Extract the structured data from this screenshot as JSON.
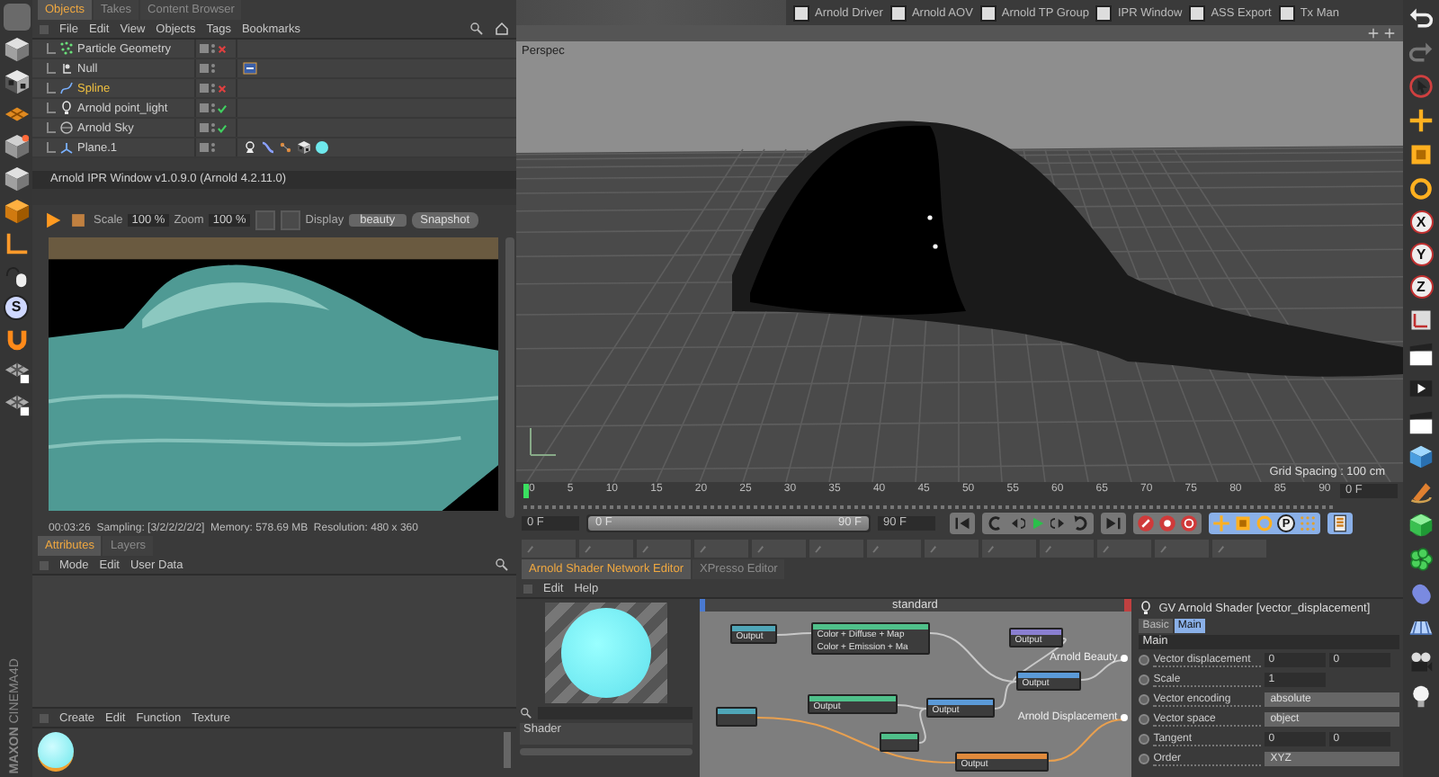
{
  "plugin_toolbar": {
    "items": [
      "Arnold Driver",
      "Arnold AOV",
      "Arnold TP Group",
      "IPR Window",
      "ASS Export",
      "Tx Man"
    ]
  },
  "left_toolbar": {
    "snap_label": "S"
  },
  "logo": {
    "brand": "MAXON",
    "product": "CINEMA4D"
  },
  "object_manager": {
    "tabs": [
      {
        "label": "Objects",
        "selected": true
      },
      {
        "label": "Takes",
        "selected": false
      },
      {
        "label": "Content Browser",
        "selected": false
      }
    ],
    "menu": [
      "File",
      "Edit",
      "View",
      "Objects",
      "Tags",
      "Bookmarks"
    ],
    "objects": [
      {
        "name": "Particle Geometry",
        "kind": "particles",
        "enabled": false,
        "selected": false
      },
      {
        "name": "Null",
        "kind": "null",
        "selected": false,
        "tags": [
          {
            "kind": "node"
          }
        ]
      },
      {
        "name": "Spline",
        "kind": "spline",
        "enabled": false,
        "selected": true
      },
      {
        "name": "Arnold point_light",
        "kind": "light",
        "enabled": true,
        "selected": false
      },
      {
        "name": "Arnold Sky",
        "kind": "sky",
        "enabled": true,
        "selected": false
      },
      {
        "name": "Plane.1",
        "kind": "plane",
        "selected": false,
        "tags": [
          {
            "kind": "lamp"
          },
          {
            "kind": "curve"
          },
          {
            "kind": "dots"
          },
          {
            "kind": "checker"
          },
          {
            "kind": "sphere"
          }
        ]
      }
    ]
  },
  "ipr_window": {
    "title": "Arnold IPR Window v1.0.9.0 (Arnold 4.2.11.0)",
    "scale_label": "Scale",
    "scale": "100 %",
    "zoom_label": "Zoom",
    "zoom": "100 %",
    "display_label": "Display",
    "display": "beauty",
    "snapshot": "Snapshot",
    "status": "00:03:26  Sampling: [3/2/2/2/2/2]  Memory: 578.69 MB  Resolution: 480 x 360"
  },
  "attribute_manager": {
    "tabs": [
      {
        "label": "Attributes",
        "selected": true
      },
      {
        "label": "Layers",
        "selected": false
      }
    ],
    "menu": [
      "Mode",
      "Edit",
      "User Data"
    ]
  },
  "material_manager": {
    "menu": [
      "Create",
      "Edit",
      "Function",
      "Texture"
    ]
  },
  "viewport": {
    "camera": "Perspec",
    "grid_spacing": "Grid Spacing : 100 cm"
  },
  "timeline": {
    "ticks": [
      "0",
      "5",
      "10",
      "15",
      "20",
      "25",
      "30",
      "35",
      "40",
      "45",
      "50",
      "55",
      "60",
      "65",
      "70",
      "75",
      "80",
      "85",
      "90"
    ],
    "level": 0,
    "current_frame": "0 F",
    "start_field": "0 F",
    "range": {
      "start": "0 F",
      "end": "90 F",
      "level": 1
    },
    "end_field": "90 F",
    "key_label": "P"
  },
  "right_toolbar": {
    "axis_locks": [
      "X",
      "Y",
      "Z"
    ]
  },
  "node_editor": {
    "tabs": [
      {
        "label": "Arnold Shader Network Editor",
        "selected": true
      },
      {
        "label": "XPresso Editor",
        "selected": false
      }
    ],
    "menu": [
      "Edit",
      "Help"
    ],
    "title": "standard",
    "ports": [
      "Arnold Beauty",
      "Arnold Displacement"
    ],
    "nodes": [
      {
        "color": "#4fa6b8",
        "lines": [
          "Output"
        ]
      },
      {
        "color": "#4fc08a",
        "lines": [
          "Color + Diffuse + Map",
          "Color + Emission + Ma"
        ]
      },
      {
        "color": "#8a7fd0",
        "lines": [
          "Output"
        ]
      },
      {
        "color": "#5b9ad8",
        "lines": [
          "Output"
        ]
      },
      {
        "color": "#4fc08a",
        "lines": [
          "Output"
        ]
      },
      {
        "color": "#5b9ad8",
        "lines": [
          "Output"
        ]
      },
      {
        "color": "#4fa6b8"
      },
      {
        "color": "#4fc08a"
      },
      {
        "color": "#e08a3c",
        "lines": [
          "Output"
        ]
      }
    ]
  },
  "shader_preview": {
    "list_label": "Shader"
  },
  "attribute_panel": {
    "title": "GV Arnold Shader [vector_displacement]",
    "tabs": [
      {
        "label": "Basic",
        "selected": false
      },
      {
        "label": "Main",
        "selected": true
      }
    ],
    "section": "Main",
    "params": [
      {
        "label": "Vector displacement",
        "kind": "vector",
        "values": [
          "0",
          "0"
        ]
      },
      {
        "label": "Scale",
        "kind": "number",
        "values": [
          "1"
        ]
      },
      {
        "label": "Vector encoding",
        "kind": "choice",
        "values": [
          "absolute"
        ]
      },
      {
        "label": "Vector space",
        "kind": "choice",
        "values": [
          "object"
        ]
      },
      {
        "label": "Tangent",
        "kind": "vector",
        "values": [
          "0",
          "0"
        ]
      },
      {
        "label": "Order",
        "kind": "choice",
        "values": [
          "XYZ"
        ]
      }
    ]
  }
}
